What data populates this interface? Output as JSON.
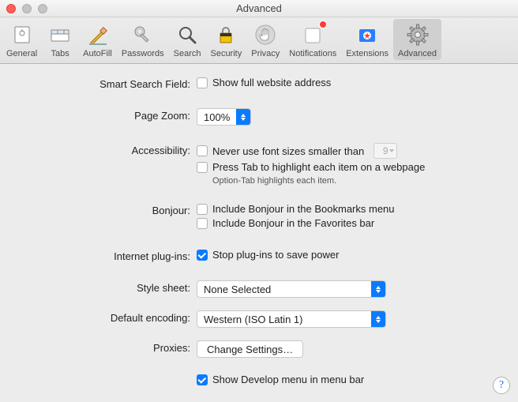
{
  "window_title": "Advanced",
  "toolbar": [
    {
      "id": "general",
      "label": "General"
    },
    {
      "id": "tabs",
      "label": "Tabs"
    },
    {
      "id": "autofill",
      "label": "AutoFill"
    },
    {
      "id": "passwords",
      "label": "Passwords"
    },
    {
      "id": "search",
      "label": "Search"
    },
    {
      "id": "security",
      "label": "Security"
    },
    {
      "id": "privacy",
      "label": "Privacy"
    },
    {
      "id": "notifications",
      "label": "Notifications"
    },
    {
      "id": "extensions",
      "label": "Extensions"
    },
    {
      "id": "advanced",
      "label": "Advanced"
    }
  ],
  "labels": {
    "smart_search": "Smart Search Field:",
    "page_zoom": "Page Zoom:",
    "accessibility": "Accessibility:",
    "bonjour": "Bonjour:",
    "plugins": "Internet plug-ins:",
    "stylesheet": "Style sheet:",
    "encoding": "Default encoding:",
    "proxies": "Proxies:"
  },
  "values": {
    "show_full_url": "Show full website address",
    "zoom_value": "100%",
    "font_min": "Never use font sizes smaller than",
    "font_min_num": "9",
    "press_tab": "Press Tab to highlight each item on a webpage",
    "option_tab_hint": "Option-Tab highlights each item.",
    "bonjour_bm": "Include Bonjour in the Bookmarks menu",
    "bonjour_fav": "Include Bonjour in the Favorites bar",
    "stop_plugins": "Stop plug-ins to save power",
    "stylesheet_sel": "None Selected",
    "encoding_sel": "Western (ISO Latin 1)",
    "change_settings": "Change Settings…",
    "show_develop": "Show Develop menu in menu bar"
  },
  "help": "?"
}
